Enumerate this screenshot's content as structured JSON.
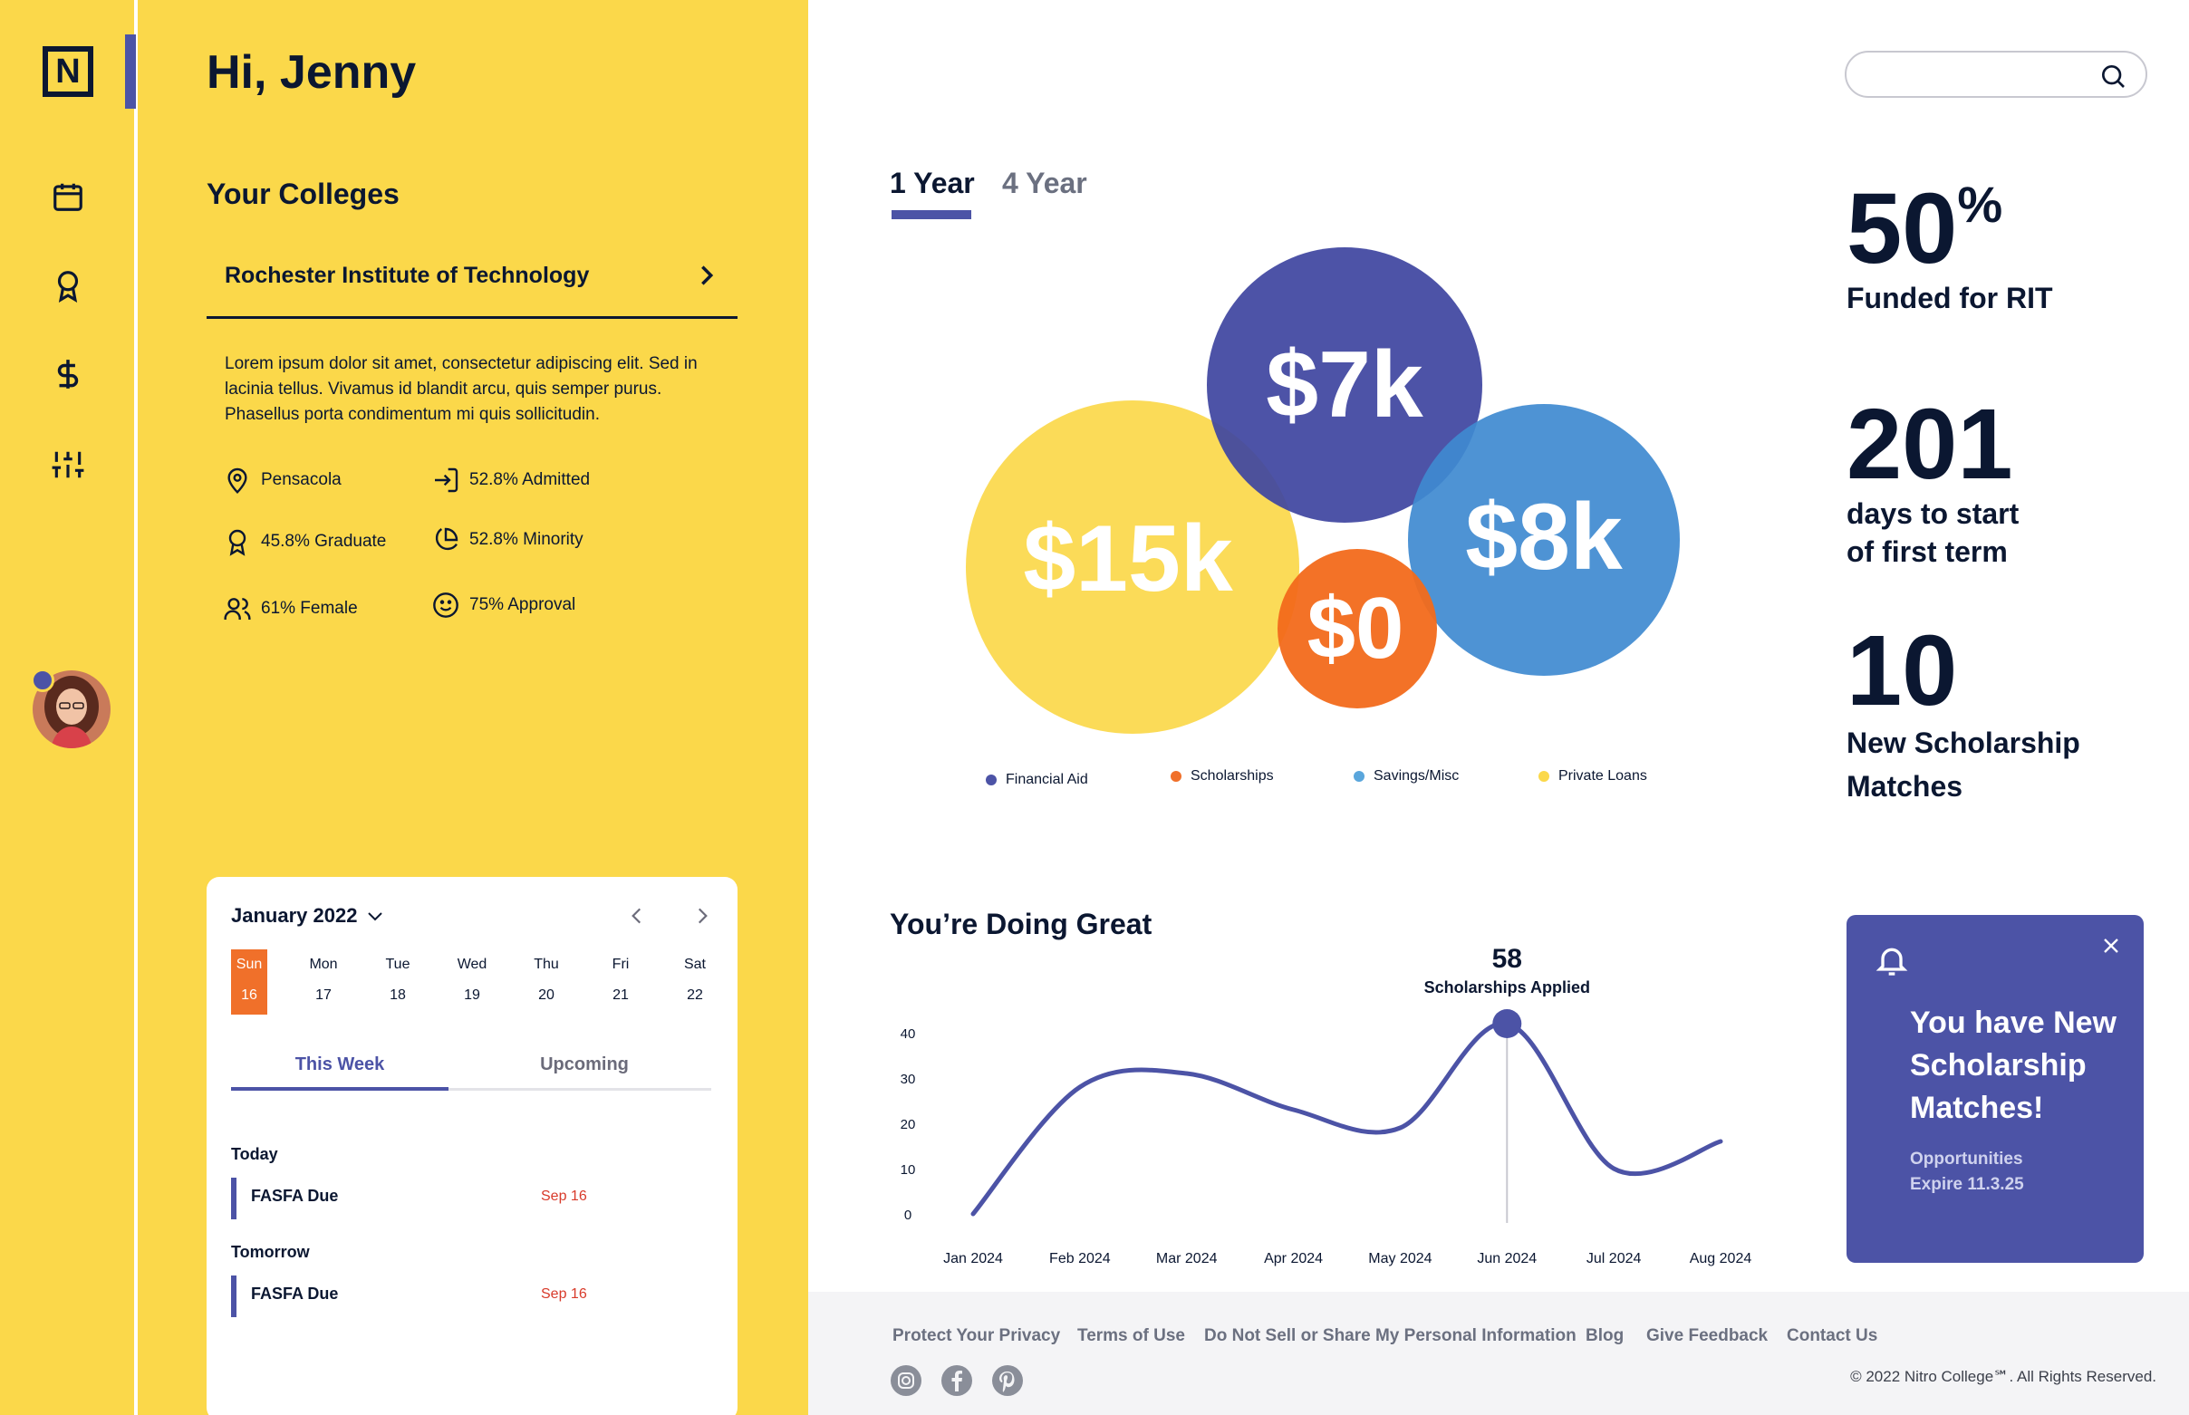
{
  "app": {
    "logo_letter": "N"
  },
  "rail": {
    "icons": [
      "calendar-icon",
      "award-icon",
      "dollar-icon",
      "sliders-icon"
    ]
  },
  "greeting": "Hi, Jenny",
  "colleges": {
    "title": "Your Colleges",
    "selected": "Rochester Institute of Technology",
    "description": "Lorem ipsum dolor sit amet, consectetur adipiscing elit. Sed in lacinia tellus. Vivamus id blandit arcu, quis semper purus. Phasellus porta condimentum mi quis sollicitudin.",
    "stats": [
      {
        "icon": "map-pin-icon",
        "label": "Pensacola"
      },
      {
        "icon": "login-icon",
        "label": "52.8% Admitted"
      },
      {
        "icon": "award-icon",
        "label": "45.8% Graduate"
      },
      {
        "icon": "pie-icon",
        "label": "52.8% Minority"
      },
      {
        "icon": "users-icon",
        "label": "61% Female"
      },
      {
        "icon": "smile-icon",
        "label": "75% Approval"
      }
    ]
  },
  "calendar": {
    "month": "January 2022",
    "days": [
      {
        "name": "Sun",
        "date": "16",
        "active": true
      },
      {
        "name": "Mon",
        "date": "17"
      },
      {
        "name": "Tue",
        "date": "18"
      },
      {
        "name": "Wed",
        "date": "19"
      },
      {
        "name": "Thu",
        "date": "20"
      },
      {
        "name": "Fri",
        "date": "21"
      },
      {
        "name": "Sat",
        "date": "22"
      }
    ],
    "tabs": [
      "This Week",
      "Upcoming"
    ],
    "groups": [
      {
        "label": "Today",
        "task": "FASFA Due",
        "date": "Sep 16"
      },
      {
        "label": "Tomorrow",
        "task": "FASFA Due",
        "date": "Sep 16"
      }
    ]
  },
  "year_tabs": [
    "1 Year",
    "4 Year"
  ],
  "bubbles": [
    {
      "label": "$15k",
      "color": "#fbd84a"
    },
    {
      "label": "$7k",
      "color": "#4c53a6"
    },
    {
      "label": "$8k",
      "color": "#4a8fd0"
    },
    {
      "label": "$0",
      "color": "#f0702a"
    }
  ],
  "legend": [
    {
      "label": "Financial Aid",
      "color": "#4c53a6"
    },
    {
      "label": "Scholarships",
      "color": "#f0702a"
    },
    {
      "label": "Savings/Misc",
      "color": "#5aa6dc"
    },
    {
      "label": "Private Loans",
      "color": "#fbd84a"
    }
  ],
  "stats_right": [
    {
      "value": "50",
      "sup": "%",
      "caption_lines": [
        "Funded for RIT"
      ]
    },
    {
      "value": "201",
      "caption_lines": [
        "days to start",
        "of first term"
      ]
    },
    {
      "value": "10",
      "caption_lines": [
        "New Scholarship",
        "Matches"
      ]
    }
  ],
  "chart_data": {
    "type": "line",
    "title": "You’re Doing Great",
    "x": [
      "Jan 2024",
      "Feb 2024",
      "Mar 2024",
      "Apr 2024",
      "May 2024",
      "Jun 2024",
      "Jul 2024",
      "Aug 2024"
    ],
    "ylim": [
      0,
      40
    ],
    "yticks": [
      0,
      10,
      20,
      30,
      40
    ],
    "series": [
      {
        "values": [
          0,
          28,
          31,
          23,
          19,
          42,
          10,
          16
        ]
      }
    ],
    "annotation": {
      "value": "58",
      "text": "Scholarships Applied",
      "x": "Jun 2024"
    },
    "grid": false
  },
  "notification": {
    "title": "You have New Scholarship Matches!",
    "sub_lines": [
      "Opportunities",
      "Expire 11.3.25"
    ]
  },
  "footer": {
    "links": [
      "Protect Your Privacy",
      "Terms of Use",
      "Do Not Sell or Share My Personal Information",
      "Blog",
      "Give Feedback",
      "Contact Us"
    ],
    "social": [
      "instagram-icon",
      "facebook-icon",
      "pinterest-icon"
    ],
    "copyright": "© 2022 Nitro College℠. All Rights Reserved."
  },
  "colors": {
    "yellow": "#fbd84a",
    "indigo": "#4c53a6",
    "orange": "#f0702a",
    "navy": "#0b1731"
  }
}
